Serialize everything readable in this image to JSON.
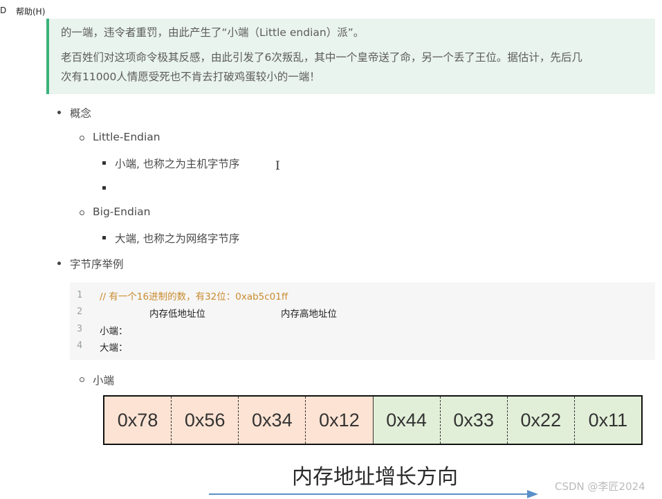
{
  "menu": {
    "item_partial": "D",
    "help": "帮助(H)"
  },
  "quote": {
    "line1": "的一端，违令者重罚，由此产生了“小端（Little endian）派”。",
    "line2a": "老百姓们对这项命令极其反感，由此引发了6次叛乱，其中一个皇帝送了命，另一个丢了王位。据估计，先后几",
    "line2b": "次有11000人情愿受死也不肯去打破鸡蛋较小的一端！"
  },
  "list": {
    "concept": "概念",
    "little_endian": "Little-Endian",
    "little_desc": "小端, 也称之为主机字节序",
    "empty_item": "",
    "big_endian": "Big-Endian",
    "big_desc": "大端, 也称之为网络字节序",
    "byte_order_example": "字节序举例",
    "small_end": "小端"
  },
  "code": {
    "line_numbers": [
      "1",
      "2",
      "3",
      "4"
    ],
    "comment": "// 有一个16进制的数，有32位：0xab5c01ff",
    "low_addr": "内存低地址位",
    "high_addr": "内存高地址位",
    "small_label": "小端：",
    "big_label": "大端："
  },
  "memory": {
    "cells": [
      "0x78",
      "0x56",
      "0x34",
      "0x12",
      "0x44",
      "0x33",
      "0x22",
      "0x11"
    ],
    "cell_colors": [
      "#fde3d3",
      "#fde3d3",
      "#fde3d3",
      "#fde3d3",
      "#e2efd8",
      "#e2efd8",
      "#e2efd8",
      "#e2efd8"
    ],
    "direction_label": "内存地址增长方向"
  },
  "watermark": "CSDN @李匠2024",
  "colors": {
    "accent_green": "#3bb37a",
    "quote_bg": "#eaf4ee",
    "code_comment": "#c98b2e",
    "arrow": "#5b8fc9"
  }
}
